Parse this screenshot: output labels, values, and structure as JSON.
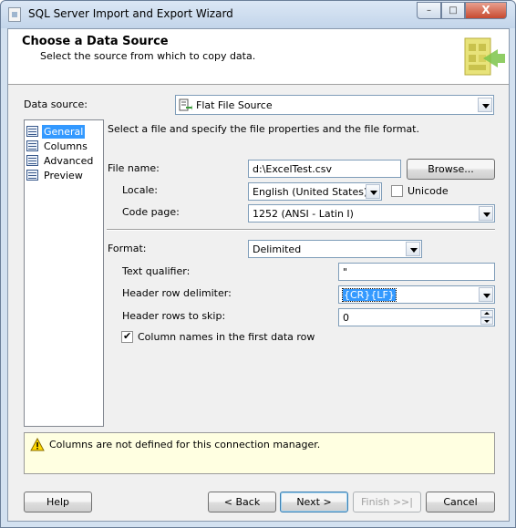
{
  "window": {
    "title": "SQL Server Import and Export Wizard",
    "controls": {
      "minimize": "–",
      "maximize": "□",
      "close": "X"
    }
  },
  "header": {
    "title": "Choose a Data Source",
    "subtitle": "Select the source from which to copy data."
  },
  "data_source": {
    "label": "Data source:",
    "value": "Flat File Source",
    "icon": "flat-file-source-icon"
  },
  "nav": {
    "items": [
      {
        "label": "General",
        "selected": true
      },
      {
        "label": "Columns",
        "selected": false
      },
      {
        "label": "Advanced",
        "selected": false
      },
      {
        "label": "Preview",
        "selected": false
      }
    ]
  },
  "general": {
    "intro": "Select a file and specify the file properties and the file format.",
    "file_name_label": "File name:",
    "file_name_value": "d:\\ExcelTest.csv",
    "browse_label": "Browse...",
    "locale_label": "Locale:",
    "locale_value": "English (United States)",
    "unicode_label": "Unicode",
    "unicode_checked": false,
    "code_page_label": "Code page:",
    "code_page_value": "1252  (ANSI - Latin I)",
    "format_label": "Format:",
    "format_value": "Delimited",
    "text_qualifier_label": "Text qualifier:",
    "text_qualifier_value": "\"",
    "header_row_delimiter_label": "Header row delimiter:",
    "header_row_delimiter_value": "{CR}{LF}",
    "header_rows_skip_label": "Header rows to skip:",
    "header_rows_skip_value": "0",
    "column_names_label": "Column names in the first data row",
    "column_names_checked": true
  },
  "message": {
    "text": "Columns are not defined for this connection manager.",
    "icon": "warning-icon"
  },
  "buttons": {
    "help": "Help",
    "back": "< Back",
    "next": "Next >",
    "finish": "Finish >>|",
    "cancel": "Cancel"
  },
  "colors": {
    "selection": "#3399ff",
    "message_bg": "#ffffe1",
    "window_frame": "#d3e1f0"
  }
}
